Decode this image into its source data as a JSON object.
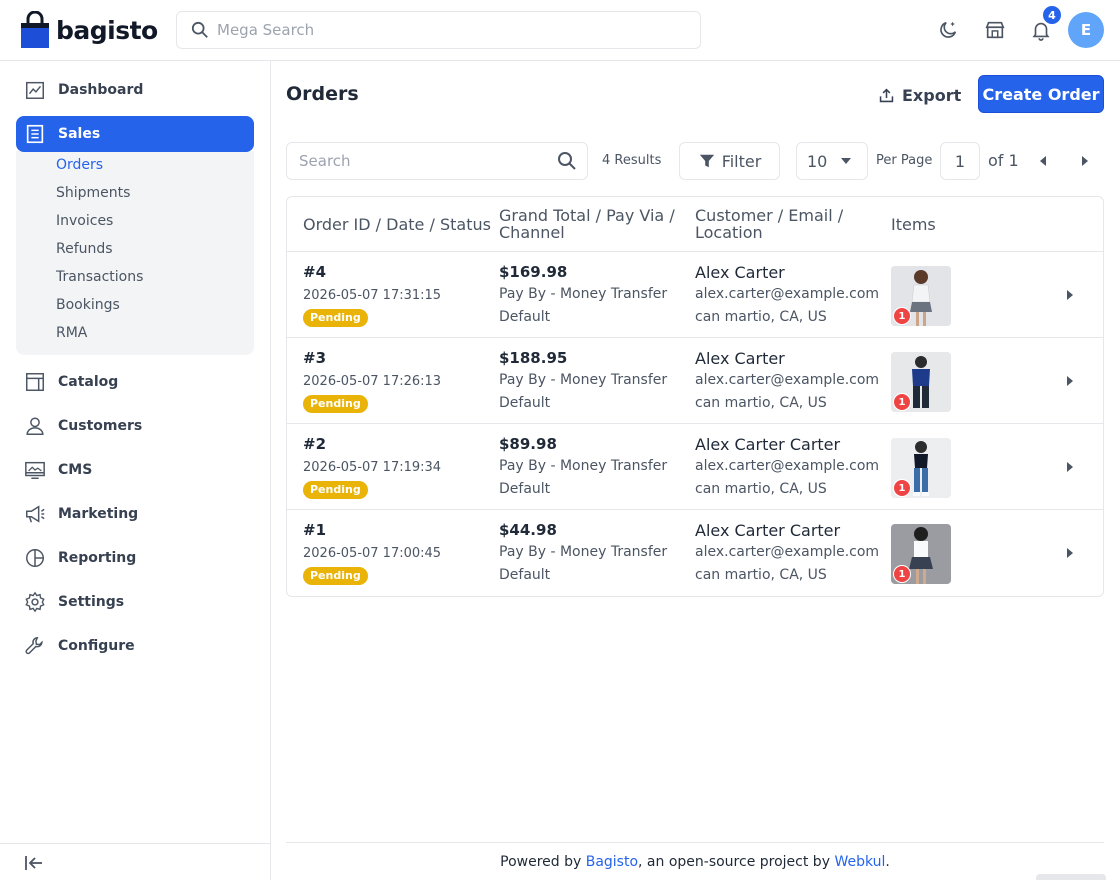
{
  "brand": {
    "name": "bagisto"
  },
  "header": {
    "search_placeholder": "Mega Search",
    "notification_count": "4",
    "avatar_initial": "E"
  },
  "sidebar": {
    "items": [
      {
        "label": "Dashboard",
        "icon": "dashboard-icon"
      },
      {
        "label": "Sales",
        "icon": "sales-icon",
        "active": true
      },
      {
        "label": "Catalog",
        "icon": "catalog-icon"
      },
      {
        "label": "Customers",
        "icon": "customers-icon"
      },
      {
        "label": "CMS",
        "icon": "cms-icon"
      },
      {
        "label": "Marketing",
        "icon": "marketing-icon"
      },
      {
        "label": "Reporting",
        "icon": "reporting-icon"
      },
      {
        "label": "Settings",
        "icon": "settings-icon"
      },
      {
        "label": "Configure",
        "icon": "configure-icon"
      }
    ],
    "sales_sub": [
      "Orders",
      "Shipments",
      "Invoices",
      "Refunds",
      "Transactions",
      "Bookings",
      "RMA"
    ]
  },
  "main": {
    "title": "Orders",
    "export_label": "Export",
    "create_label": "Create Order",
    "search_placeholder": "Search",
    "results": "4 Results",
    "filter_label": "Filter",
    "per_page_value": "10",
    "per_page_label": "Per Page",
    "page_current": "1",
    "page_of": "of 1"
  },
  "table": {
    "headers": [
      "Order ID / Date / Status",
      "Grand Total / Pay Via / Channel",
      "Customer / Email / Location",
      "Items"
    ],
    "rows": [
      {
        "id": "#4",
        "date": "2026-05-07 17:31:15",
        "status": "Pending",
        "total": "$169.98",
        "pay": "Pay By - Money Transfer",
        "channel": "Default",
        "name": "Alex Carter",
        "email": "alex.carter@example.com",
        "location": "can martio, CA, US",
        "qty": "1"
      },
      {
        "id": "#3",
        "date": "2026-05-07 17:26:13",
        "status": "Pending",
        "total": "$188.95",
        "pay": "Pay By - Money Transfer",
        "channel": "Default",
        "name": "Alex Carter",
        "email": "alex.carter@example.com",
        "location": "can martio, CA, US",
        "qty": "1"
      },
      {
        "id": "#2",
        "date": "2026-05-07 17:19:34",
        "status": "Pending",
        "total": "$89.98",
        "pay": "Pay By - Money Transfer",
        "channel": "Default",
        "name": "Alex Carter Carter",
        "email": "alex.carter@example.com",
        "location": "can martio, CA, US",
        "qty": "1"
      },
      {
        "id": "#1",
        "date": "2026-05-07 17:00:45",
        "status": "Pending",
        "total": "$44.98",
        "pay": "Pay By - Money Transfer",
        "channel": "Default",
        "name": "Alex Carter Carter",
        "email": "alex.carter@example.com",
        "location": "can martio, CA, US",
        "qty": "1"
      }
    ]
  },
  "footer": {
    "prefix": "Powered by ",
    "link1": "Bagisto",
    "middle": ", an open-source project by ",
    "link2": "Webkul",
    "suffix": "."
  },
  "colors": {
    "primary": "#2563eb",
    "pending": "#eab308",
    "qty_badge": "#ef4444"
  }
}
